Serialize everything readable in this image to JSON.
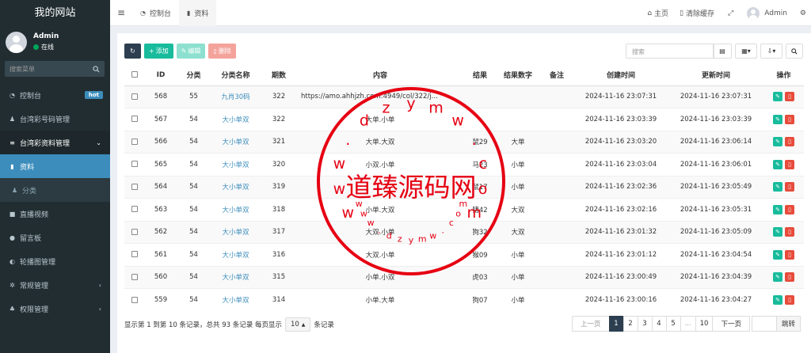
{
  "sidebar": {
    "site_title": "我的网站",
    "user": {
      "name": "Admin",
      "status": "在线"
    },
    "search_placeholder": "搜索菜单",
    "items": [
      {
        "label": "控制台",
        "badge": "hot"
      },
      {
        "label": "台湾彩号码管理"
      },
      {
        "label": "台湾彩资料管理"
      },
      {
        "label": "资料"
      },
      {
        "label": "分类"
      },
      {
        "label": "直播视频"
      },
      {
        "label": "留言板"
      },
      {
        "label": "轮播图管理"
      },
      {
        "label": "常规管理"
      },
      {
        "label": "权限管理"
      }
    ]
  },
  "topbar": {
    "tabs": [
      {
        "label": "控制台"
      },
      {
        "label": "资料"
      }
    ],
    "home": "主页",
    "clear_cache": "清除缓存",
    "user": "Admin"
  },
  "toolbar": {
    "add": "添加",
    "edit": "编辑",
    "del": "删除",
    "search_placeholder": "搜索"
  },
  "table": {
    "headers": [
      "ID",
      "分类",
      "分类名称",
      "期数",
      "内容",
      "结果",
      "结果数字",
      "备注",
      "创建时间",
      "更新时间",
      "操作"
    ],
    "rows": [
      {
        "id": "568",
        "cat": "55",
        "cat_name": "九肖30码",
        "period": "322",
        "content": "https://amo.ahhjzh.com:4949/col/322/j...",
        "result": "",
        "result_num": "",
        "note": "",
        "created": "2024-11-16 23:07:31",
        "updated": "2024-11-16 23:07:31"
      },
      {
        "id": "567",
        "cat": "54",
        "cat_name": "大小单双",
        "period": "322",
        "content": "大单.小单",
        "result": "",
        "result_num": "",
        "note": "",
        "created": "2024-11-16 23:03:39",
        "updated": "2024-11-16 23:03:39"
      },
      {
        "id": "566",
        "cat": "54",
        "cat_name": "大小单双",
        "period": "321",
        "content": "大单.大双",
        "result": "鼠29",
        "result_num": "大单",
        "note": "",
        "created": "2024-11-16 23:03:20",
        "updated": "2024-11-16 23:06:14"
      },
      {
        "id": "565",
        "cat": "54",
        "cat_name": "大小单双",
        "period": "320",
        "content": "小双.小单",
        "result": "马23",
        "result_num": "小单",
        "note": "",
        "created": "2024-11-16 23:03:04",
        "updated": "2024-11-16 23:06:01"
      },
      {
        "id": "564",
        "cat": "54",
        "cat_name": "大小单双",
        "period": "319",
        "content": "",
        "result": "鼠17",
        "result_num": "小单",
        "note": "",
        "created": "2024-11-16 23:02:36",
        "updated": "2024-11-16 23:05:49"
      },
      {
        "id": "563",
        "cat": "54",
        "cat_name": "大小单双",
        "period": "318",
        "content": "小单.大双",
        "result": "猪42",
        "result_num": "大双",
        "note": "",
        "created": "2024-11-16 23:02:16",
        "updated": "2024-11-16 23:05:31"
      },
      {
        "id": "562",
        "cat": "54",
        "cat_name": "大小单双",
        "period": "317",
        "content": "大双.小单",
        "result": "狗32",
        "result_num": "大双",
        "note": "",
        "created": "2024-11-16 23:01:32",
        "updated": "2024-11-16 23:05:09"
      },
      {
        "id": "561",
        "cat": "54",
        "cat_name": "大小单双",
        "period": "316",
        "content": "大双.小单",
        "result": "猴09",
        "result_num": "小单",
        "note": "",
        "created": "2024-11-16 23:01:12",
        "updated": "2024-11-16 23:04:54"
      },
      {
        "id": "560",
        "cat": "54",
        "cat_name": "大小单双",
        "period": "315",
        "content": "小单.小双",
        "result": "虎03",
        "result_num": "小单",
        "note": "",
        "created": "2024-11-16 23:00:49",
        "updated": "2024-11-16 23:04:39"
      },
      {
        "id": "559",
        "cat": "54",
        "cat_name": "大小单双",
        "period": "314",
        "content": "小单.大单",
        "result": "狗07",
        "result_num": "小单",
        "note": "",
        "created": "2024-11-16 23:00:16",
        "updated": "2024-11-16 23:04:27"
      }
    ]
  },
  "footer": {
    "info_before": "显示第 1 到第 10 条记录，总共 93 条记录 每页显示",
    "page_size": "10",
    "info_after": "条记录"
  },
  "pagination": {
    "prev": "上一页",
    "pages": [
      "1",
      "2",
      "3",
      "4",
      "5",
      "...",
      "10"
    ],
    "next": "下一页",
    "jump": "跳转",
    "current": "1"
  },
  "watermark": {
    "text": "道臻源码网",
    "url_letters": [
      "w",
      "w",
      "w",
      ".",
      "d",
      "z",
      "y",
      "m",
      "w",
      ".",
      "c",
      "o",
      "m"
    ],
    "color": "#e60012"
  }
}
